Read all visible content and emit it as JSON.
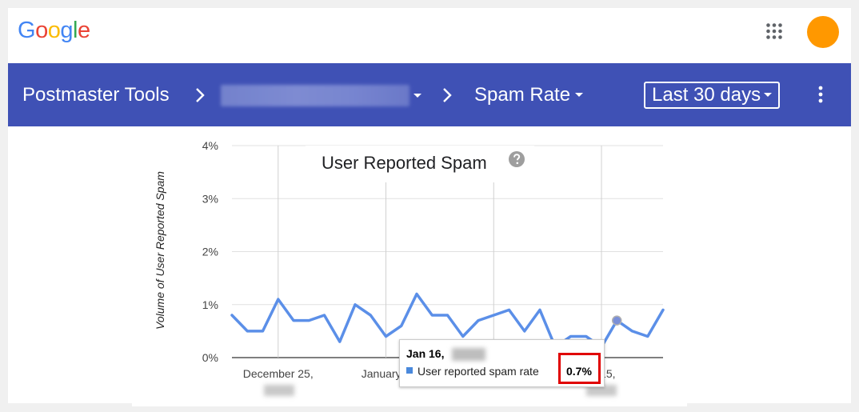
{
  "header": {
    "logo_text": "Google",
    "logo_colors": [
      "#4285F4",
      "#EA4335",
      "#FBBC05",
      "#4285F4",
      "#34A853",
      "#EA4335"
    ],
    "apps_icon": "apps-grid-icon",
    "avatar_color": "#FF9800"
  },
  "toolbar": {
    "background": "#3F51B5",
    "title": "Postmaster Tools",
    "report": "Spam Rate",
    "date_range": "Last 30 days",
    "separator_icon": "chevron-right-icon",
    "dropdown_icon": "caret-down-icon",
    "more_icon": "more-vert-icon"
  },
  "chart": {
    "help_icon": "help-circle-icon",
    "tooltip": {
      "date": "Jan 16,",
      "series": "User reported spam rate",
      "value": "0.7%",
      "swatch_color": "#4A89DC"
    },
    "highlight_color": "#E00000"
  },
  "chart_data": {
    "type": "line",
    "title": "User Reported Spam",
    "ylabel": "Volume of User Reported Spam",
    "xlabel": "",
    "ylim": [
      0,
      4
    ],
    "y_ticks": [
      "0%",
      "1%",
      "2%",
      "3%",
      "4%"
    ],
    "x_tick_labels": [
      "December 25,",
      "January 1",
      "ry 15,"
    ],
    "grid": true,
    "legend": "none",
    "series": [
      {
        "color": "#5B8FE8",
        "values": [
          0.8,
          0.5,
          0.5,
          1.1,
          0.7,
          0.7,
          0.8,
          0.3,
          1.0,
          0.8,
          0.4,
          0.6,
          1.2,
          0.8,
          0.8,
          0.4,
          0.7,
          0.8,
          0.9,
          0.5,
          0.9,
          0.2,
          0.4,
          0.4,
          0.2,
          0.7,
          0.5,
          0.4,
          0.9
        ]
      }
    ],
    "highlighted_point": 25
  }
}
